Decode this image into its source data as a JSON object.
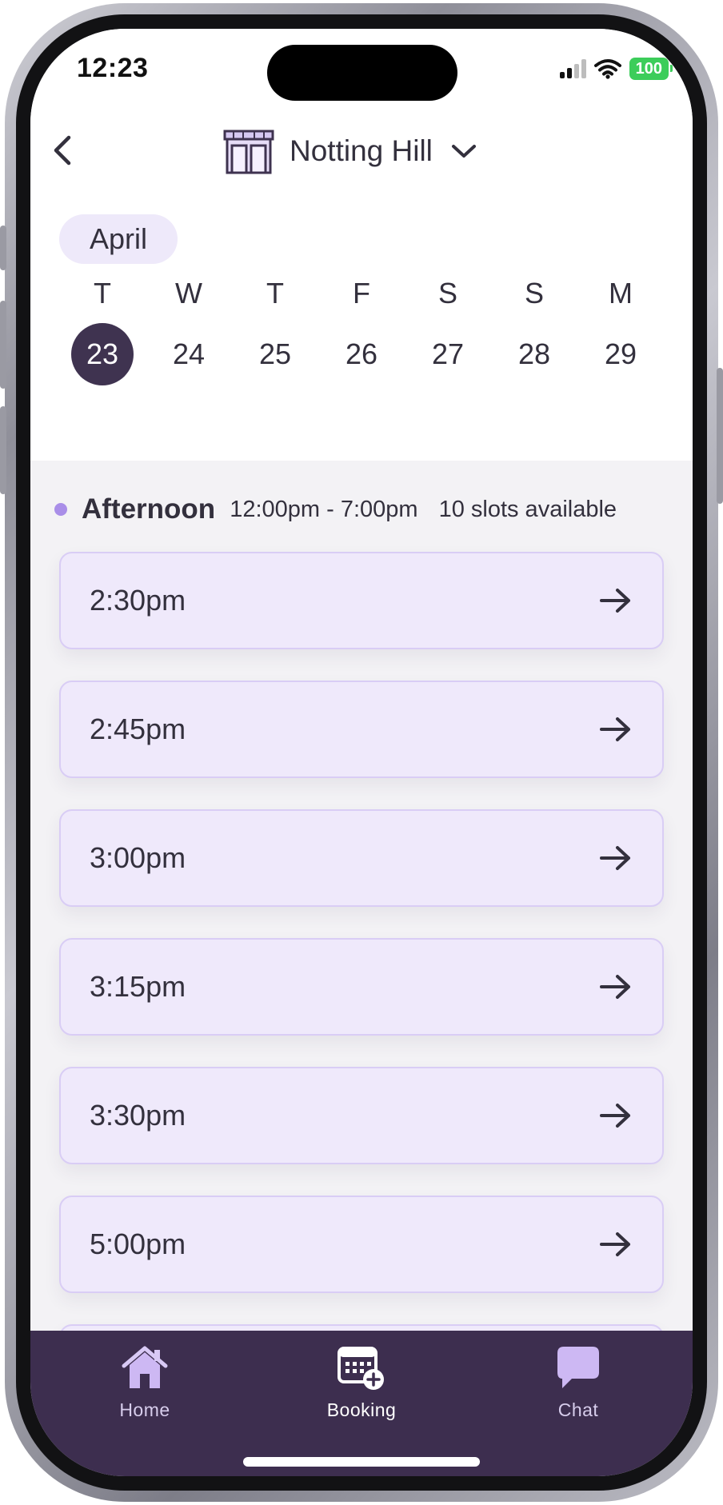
{
  "status_bar": {
    "time": "12:23",
    "battery": "100"
  },
  "header": {
    "location": "Notting Hill",
    "location_icon": "storefront-icon"
  },
  "calendar": {
    "month": "April",
    "days": [
      {
        "weekday": "T",
        "date": "23",
        "selected": true
      },
      {
        "weekday": "W",
        "date": "24"
      },
      {
        "weekday": "T",
        "date": "25"
      },
      {
        "weekday": "F",
        "date": "26"
      },
      {
        "weekday": "S",
        "date": "27"
      },
      {
        "weekday": "S",
        "date": "28"
      },
      {
        "weekday": "M",
        "date": "29"
      }
    ]
  },
  "section": {
    "title": "Afternoon",
    "range": "12:00pm - 7:00pm",
    "slots_available": "10 slots available"
  },
  "slots": [
    "2:30pm",
    "2:45pm",
    "3:00pm",
    "3:15pm",
    "3:30pm",
    "5:00pm"
  ],
  "tabs": [
    {
      "label": "Home",
      "icon": "home-icon"
    },
    {
      "label": "Booking",
      "icon": "calendar-add-icon",
      "active": true
    },
    {
      "label": "Chat",
      "icon": "chat-icon"
    }
  ],
  "colors": {
    "accent": "#3d2e4f",
    "slot_bg": "#efe9fb",
    "slot_border": "#d9cdf5",
    "dot": "#a98ee8",
    "battery": "#3ccd5a"
  }
}
